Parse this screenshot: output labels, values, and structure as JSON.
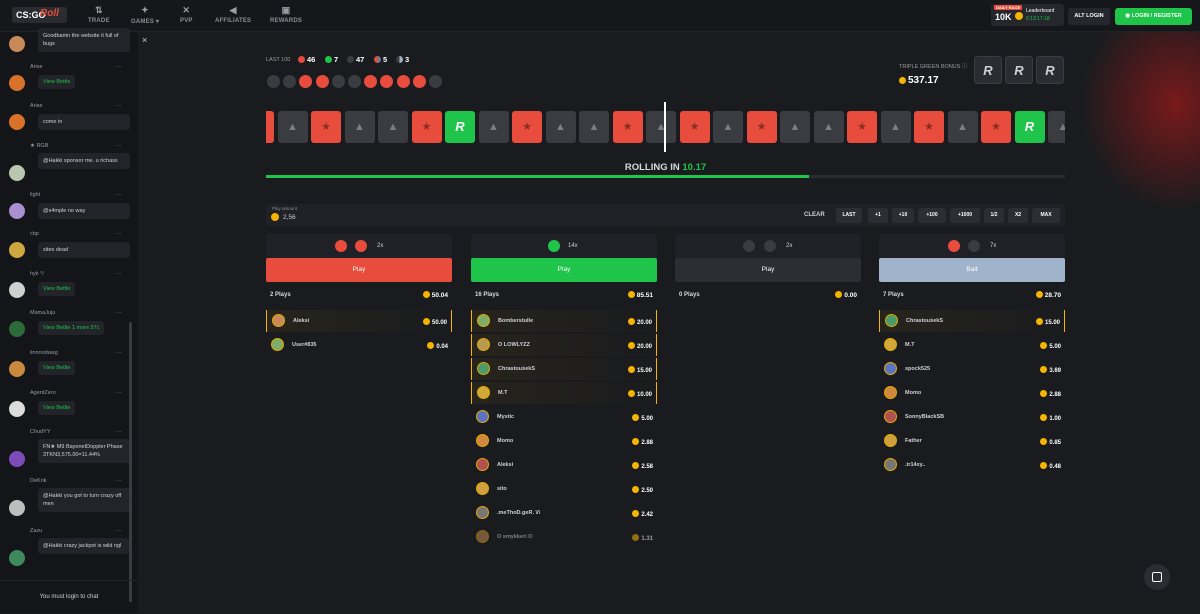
{
  "nav": {
    "logo_text": "CS:GO",
    "logo_accent": "Roll",
    "items": [
      {
        "label": "TRADE",
        "icon": "trade-icon"
      },
      {
        "label": "GAMES ▾",
        "icon": "games-icon"
      },
      {
        "label": "PVP",
        "icon": "swords-icon"
      },
      {
        "label": "AFFILIATES",
        "icon": "megaphone-icon"
      },
      {
        "label": "REWARDS",
        "icon": "gift-icon"
      }
    ],
    "race_tag": "DAILY RACE",
    "race_amount": "10K",
    "race_label": "Leaderboard",
    "race_time": "6:13:17:18",
    "alt_login": "ALT LOGIN",
    "login_register": "LOGIN / REGISTER"
  },
  "chat": {
    "messages": [
      {
        "name": "",
        "text": "Goodbamn the website it full of bugs"
      },
      {
        "name": "Arise",
        "text": "View Bettle",
        "link": true
      },
      {
        "name": "Arise",
        "text": "come in"
      },
      {
        "name": "★ RGB",
        "text": "@Hakki sponsor me. u richass"
      },
      {
        "name": "light",
        "text": "@s4mple no way"
      },
      {
        "name": "cbp",
        "text": "sites dead"
      },
      {
        "name": "hyk °/",
        "text": "View Bettle",
        "link": true
      },
      {
        "name": "MamaJuju",
        "text": "View Bettle 1 more 57c",
        "link": true
      },
      {
        "name": "iinnnodawg",
        "text": "View Bettle",
        "link": true
      },
      {
        "name": "AgentZero",
        "text": "View Bettle",
        "link": true
      },
      {
        "name": "ChudYY",
        "text": "FN★ M9 BayonetDoppler Phase 3TKN3,575.00=11.44%"
      },
      {
        "name": "DeKnk",
        "text": "@Hakki you got to turn crazy off men"
      },
      {
        "name": "Zazu",
        "text": "@Hakki crazy jackpot is wild ngl"
      }
    ],
    "footer": "You must login to chat",
    "close": "×"
  },
  "roll": {
    "last_label": "LAST 100",
    "counts": {
      "red": "46",
      "green": "7",
      "dark": "47",
      "bait_red": "5",
      "bait_dark": "3"
    },
    "history": [
      "d",
      "d",
      "r",
      "r",
      "d",
      "d",
      "r",
      "r",
      "r",
      "r",
      "d"
    ],
    "triple_label": "TRIPLE GREEN BONUS",
    "triple_value": "537.17",
    "strip": [
      "r",
      "d",
      "r",
      "d",
      "d",
      "r",
      "g",
      "d",
      "r",
      "d",
      "d",
      "r",
      "d",
      "r",
      "d",
      "r",
      "d",
      "d",
      "r",
      "d",
      "r",
      "d",
      "r",
      "g",
      "d",
      "r",
      "d"
    ],
    "rolling_label": "ROLLING IN",
    "rolling_value": "10.17",
    "progress": 0.68
  },
  "bet": {
    "label": "Play amount",
    "amount": "2,56",
    "clear": "CLEAR",
    "quick": [
      "LAST",
      "+1",
      "+10",
      "+100",
      "+1000",
      "1/2",
      "X2",
      "MAX"
    ]
  },
  "columns": [
    {
      "mult": "2x",
      "button": "Play",
      "btn_color": "#e74c3c",
      "plays": "2 Plays",
      "total": "50.04",
      "rows": [
        {
          "name": "Aleksi",
          "value": "50.00",
          "hl": true
        },
        {
          "name": "User#835",
          "value": "0.04"
        }
      ]
    },
    {
      "mult": "14x",
      "button": "Play",
      "btn_color": "#1fc44a",
      "plays": "16 Plays",
      "total": "85.51",
      "rows": [
        {
          "name": "Bomberstulle",
          "value": "20.00",
          "hl": true
        },
        {
          "name": "O LOWLYZZ",
          "value": "20.00",
          "hl": true
        },
        {
          "name": "ChrastouśekS",
          "value": "15.00",
          "hl": true
        },
        {
          "name": "M.T",
          "value": "10.00",
          "hl": true
        },
        {
          "name": "Mystic",
          "value": "5.00"
        },
        {
          "name": "Momo",
          "value": "2.88"
        },
        {
          "name": "Aleksi",
          "value": "2.58"
        },
        {
          "name": "sito",
          "value": "2.50"
        },
        {
          "name": ".meThoD.geR. \\/\\",
          "value": "2.42"
        },
        {
          "name": "O smykkeri O",
          "value": "1.31"
        }
      ]
    },
    {
      "mult": "2x",
      "button": "Play",
      "btn_color": "#2c2e34",
      "plays": "0 Plays",
      "total": "0.00",
      "rows": []
    },
    {
      "mult": "7x",
      "button": "Bait",
      "btn_color": "#9fb4cb",
      "plays": "7 Plays",
      "total": "28.70",
      "rows": [
        {
          "name": "ChrastouśekS",
          "value": "15.00",
          "hl": true
        },
        {
          "name": "M.T",
          "value": "5.00"
        },
        {
          "name": "spock525",
          "value": "3.69"
        },
        {
          "name": "Momo",
          "value": "2.88"
        },
        {
          "name": "SonnyBlackSB",
          "value": "1.00"
        },
        {
          "name": "Father",
          "value": "0.85"
        },
        {
          "name": ".tr14xy..",
          "value": "0.48"
        }
      ]
    }
  ]
}
